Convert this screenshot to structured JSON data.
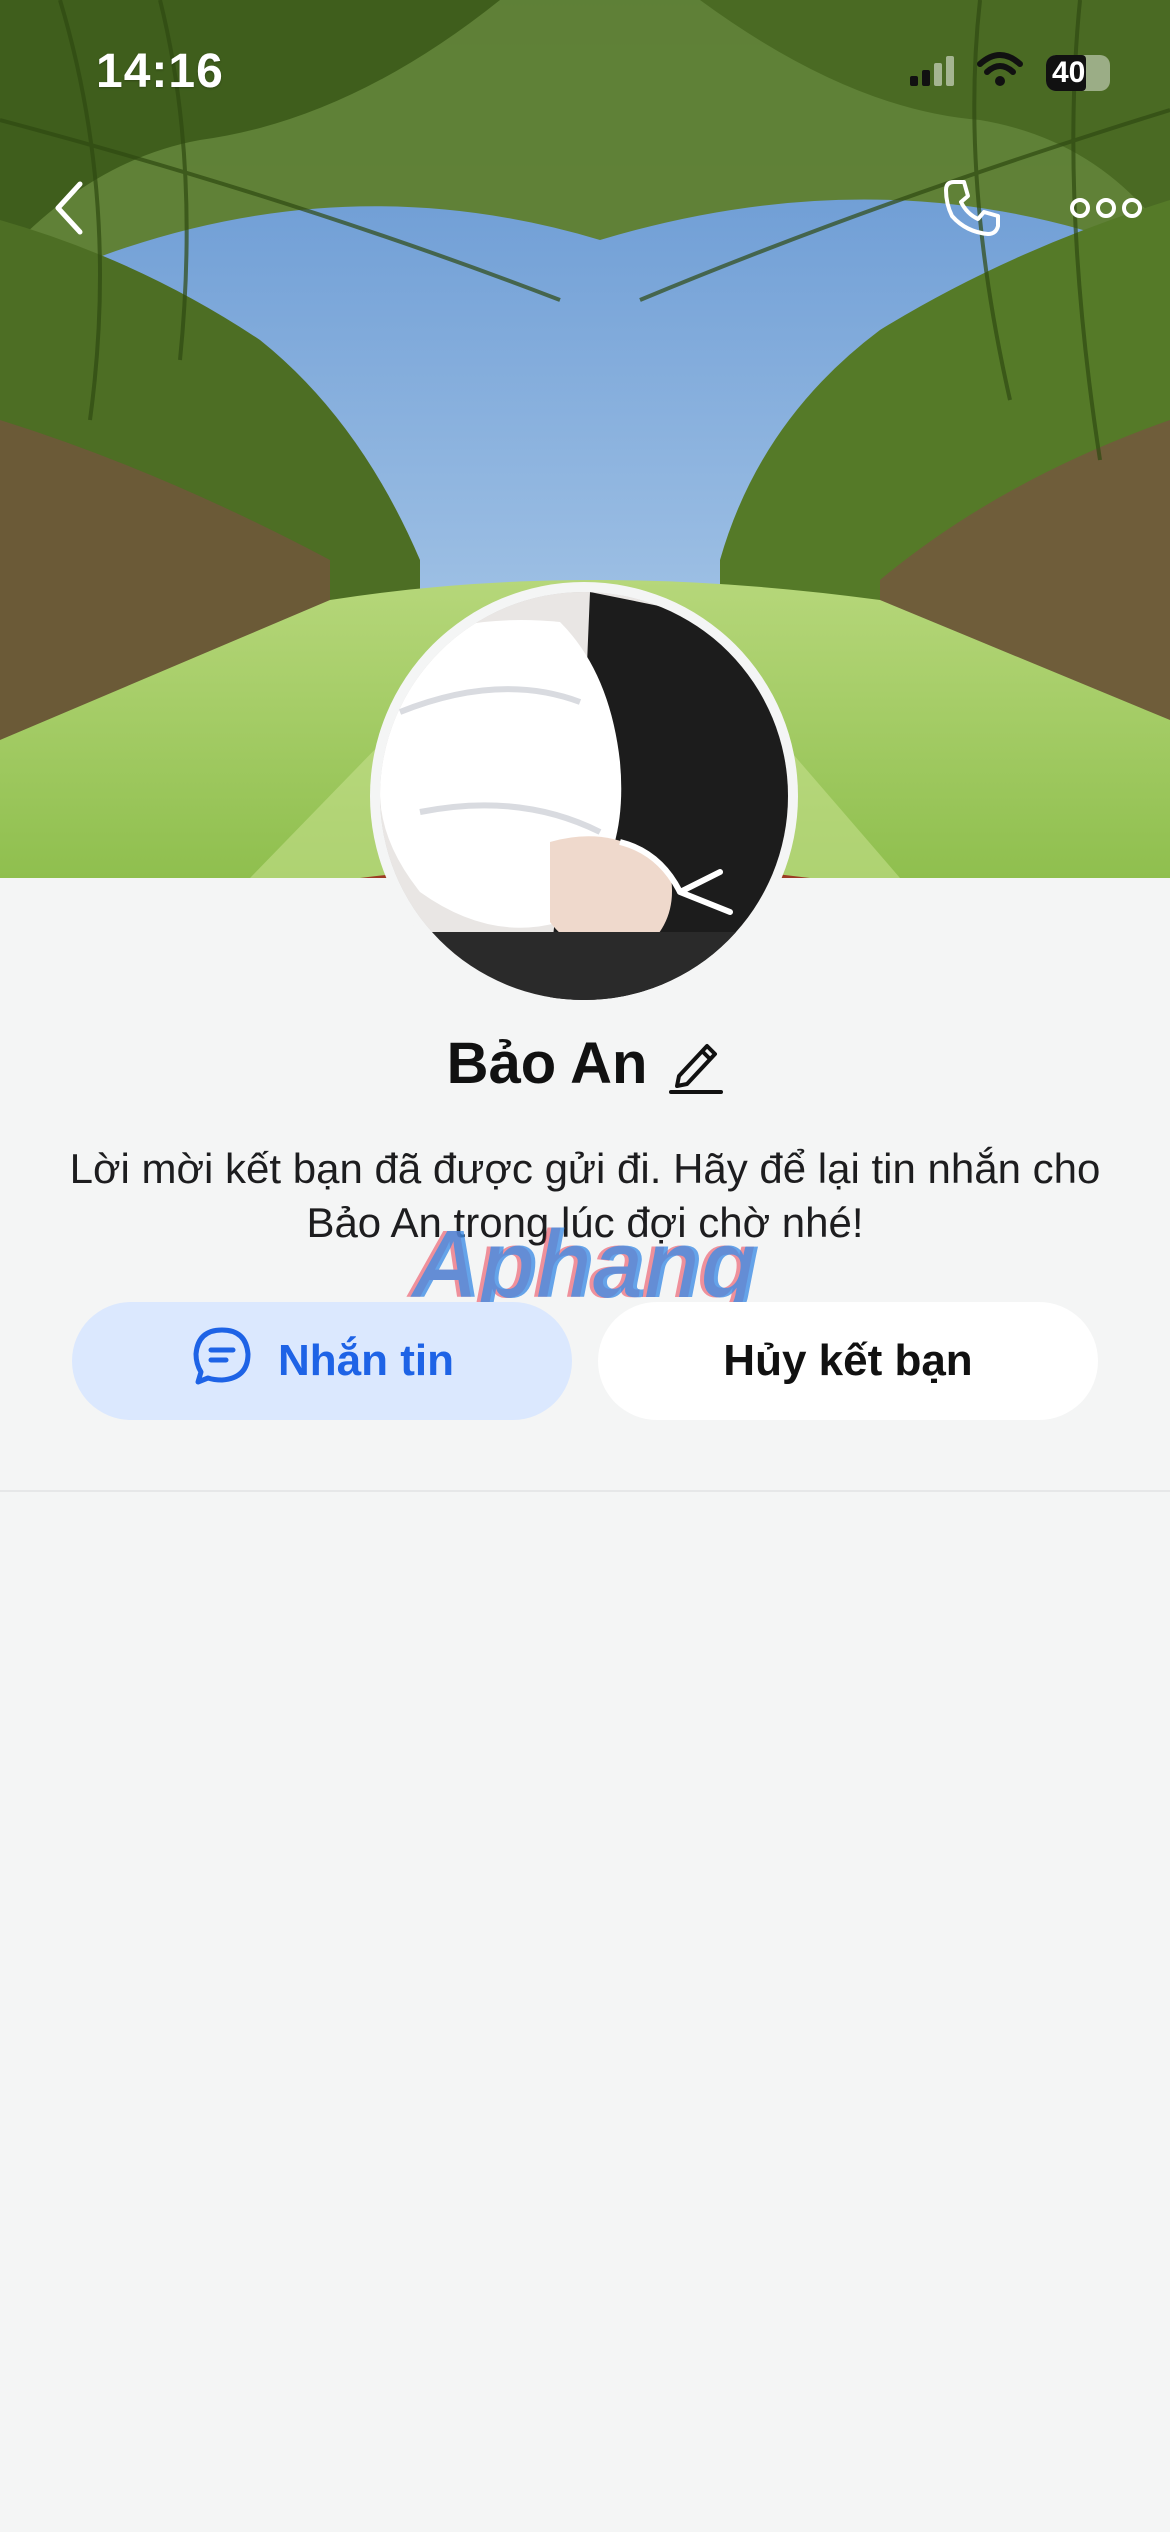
{
  "status_bar": {
    "time": "14:16",
    "battery": "40"
  },
  "nav": {
    "back_icon": "chevron-left-icon",
    "call_icon": "phone-icon",
    "more_icon": "more-dots-icon"
  },
  "profile": {
    "name": "Bảo An",
    "edit_icon": "pencil-icon",
    "message": "Lời mời kết bạn đã được gửi đi. Hãy để lại tin nhắn cho Bảo An trong lúc đợi chờ nhé!"
  },
  "watermark": "Aphang",
  "actions": {
    "message_label": "Nhắn tin",
    "message_icon": "chat-bubble-icon",
    "unfriend_label": "Hủy kết bạn"
  },
  "colors": {
    "accent": "#1e63e6",
    "accent_bg": "#dbe8fe",
    "background": "#f4f5f5"
  }
}
